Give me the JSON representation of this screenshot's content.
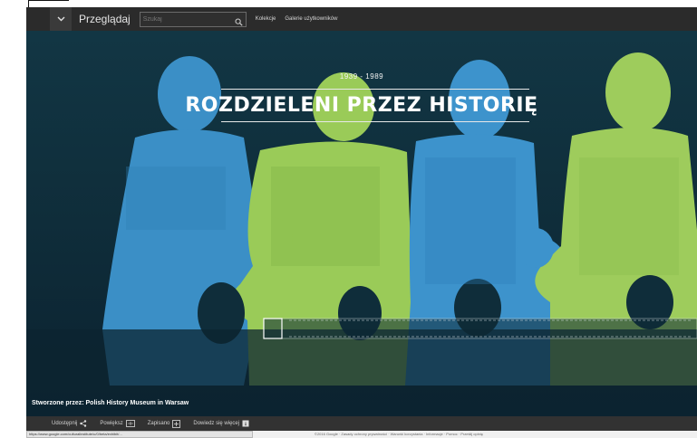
{
  "topbar": {
    "menu_icon": "chevron-down-icon",
    "browse_label": "Przeglądaj",
    "search_placeholder": "Szukaj",
    "search_icon": "search-icon",
    "links": [
      "Kolekcje",
      "Galerie użytkowników"
    ]
  },
  "hero": {
    "years": "1939 - 1989",
    "title": "ROZDZIELENI PRZEZ HISTORIĘ",
    "credit": "Stworzone przez: Polish History Museum in Warsaw",
    "colors": {
      "blue": "#3f95cf",
      "green": "#9dcd5a",
      "dark": "#0f2d3a"
    }
  },
  "sharebar": {
    "items": [
      {
        "label": "Udostępnij",
        "icon": "share-icon"
      },
      {
        "label": "Powiększ",
        "icon": "fullscreen-icon"
      },
      {
        "label": "Zapisano",
        "icon": "plus-icon"
      },
      {
        "label": "Dowiedz się więcej",
        "icon": "info-icon"
      }
    ]
  },
  "footer": {
    "status_url": "https://www.google.com/culturalinstitute/u/0/beta/exhibit/...",
    "links": "©2016 Google · Zasady ochrony prywatności · Warunki korzystania · Informacje · Pomoc · Prześlij opinię"
  }
}
